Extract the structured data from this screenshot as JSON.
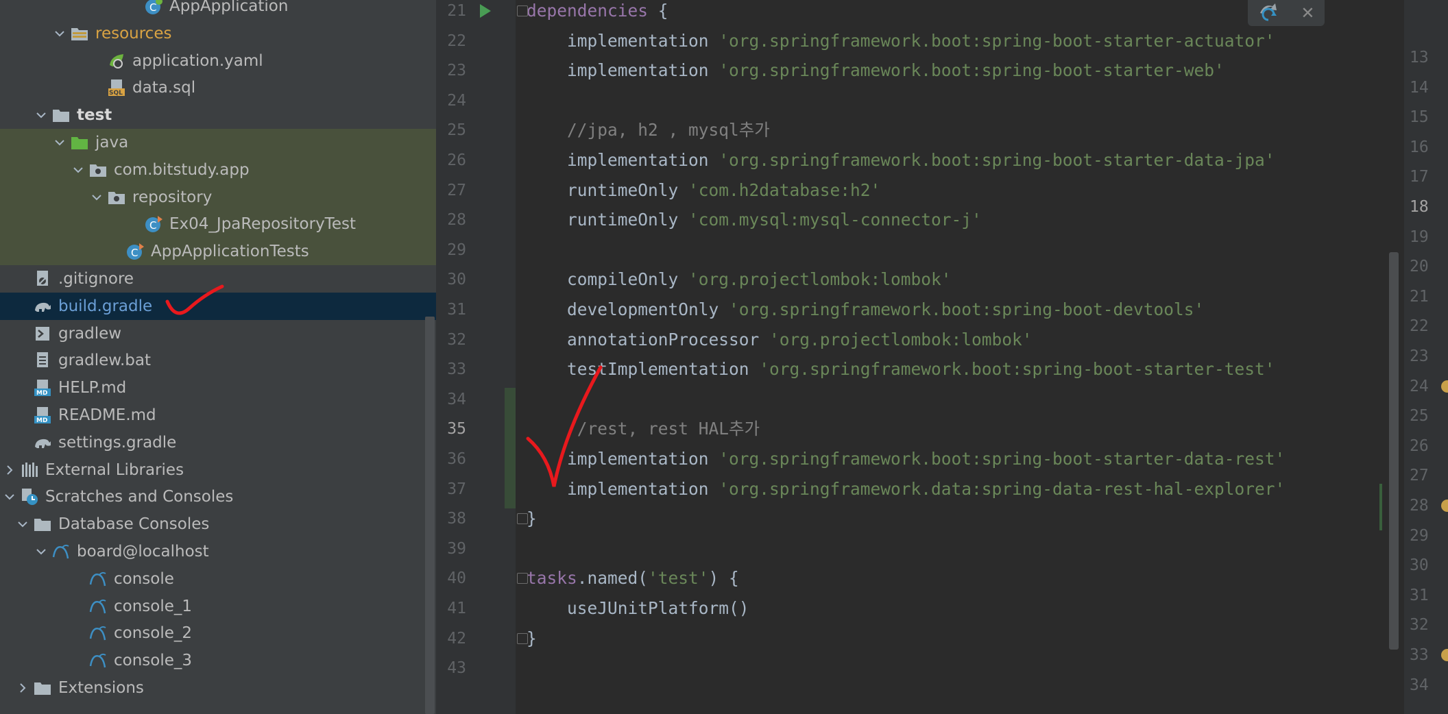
{
  "tree": {
    "items": [
      {
        "label": "AppApplication",
        "indent": 7,
        "arrow": "",
        "icon": "spring-class-icon",
        "style": "",
        "scope": ""
      },
      {
        "label": "resources",
        "indent": 3,
        "arrow": "v",
        "icon": "resources-folder-icon",
        "style": "",
        "scope": ""
      },
      {
        "label": "application.yaml",
        "indent": 5,
        "arrow": "",
        "icon": "spring-yaml-icon",
        "style": "",
        "scope": ""
      },
      {
        "label": "data.sql",
        "indent": 5,
        "arrow": "",
        "icon": "sql-file-icon",
        "style": "",
        "scope": ""
      },
      {
        "label": "test",
        "indent": 2,
        "arrow": "v",
        "icon": "folder-icon",
        "style": "bold",
        "scope": ""
      },
      {
        "label": "java",
        "indent": 3,
        "arrow": "v",
        "icon": "test-folder-icon",
        "style": "",
        "scope": "test"
      },
      {
        "label": "com.bitstudy.app",
        "indent": 4,
        "arrow": "v",
        "icon": "package-icon",
        "style": "",
        "scope": "test"
      },
      {
        "label": "repository",
        "indent": 5,
        "arrow": "v",
        "icon": "package-icon",
        "style": "",
        "scope": "test"
      },
      {
        "label": "Ex04_JpaRepositoryTest",
        "indent": 7,
        "arrow": "",
        "icon": "test-class-icon",
        "style": "",
        "scope": "test"
      },
      {
        "label": "AppApplicationTests",
        "indent": 6,
        "arrow": "",
        "icon": "test-class-icon",
        "style": "",
        "scope": "test"
      },
      {
        "label": ".gitignore",
        "indent": 1,
        "arrow": "",
        "icon": "gitignore-file-icon",
        "style": "",
        "scope": ""
      },
      {
        "label": "build.gradle",
        "indent": 1,
        "arrow": "",
        "icon": "gradle-icon",
        "style": "blue",
        "scope": "selected"
      },
      {
        "label": "gradlew",
        "indent": 1,
        "arrow": "",
        "icon": "shell-script-icon",
        "style": "",
        "scope": ""
      },
      {
        "label": "gradlew.bat",
        "indent": 1,
        "arrow": "",
        "icon": "text-file-icon",
        "style": "",
        "scope": ""
      },
      {
        "label": "HELP.md",
        "indent": 1,
        "arrow": "",
        "icon": "markdown-icon",
        "style": "",
        "scope": ""
      },
      {
        "label": "README.md",
        "indent": 1,
        "arrow": "",
        "icon": "markdown-icon",
        "style": "",
        "scope": ""
      },
      {
        "label": "settings.gradle",
        "indent": 1,
        "arrow": "",
        "icon": "gradle-icon",
        "style": "",
        "scope": ""
      },
      {
        "label": "External Libraries",
        "indent": 0,
        "arrow": ">",
        "icon": "libraries-icon",
        "style": "",
        "scope": ""
      },
      {
        "label": "Scratches and Consoles",
        "indent": 0,
        "arrow": "v",
        "icon": "scratches-icon",
        "style": "",
        "scope": ""
      },
      {
        "label": "Database Consoles",
        "indent": 1,
        "arrow": "v",
        "icon": "folder-icon",
        "style": "",
        "scope": ""
      },
      {
        "label": "board@localhost",
        "indent": 2,
        "arrow": "v",
        "icon": "mysql-icon",
        "style": "",
        "scope": ""
      },
      {
        "label": "console",
        "indent": 4,
        "arrow": "",
        "icon": "mysql-icon",
        "style": "",
        "scope": ""
      },
      {
        "label": "console_1",
        "indent": 4,
        "arrow": "",
        "icon": "mysql-icon",
        "style": "",
        "scope": ""
      },
      {
        "label": "console_2",
        "indent": 4,
        "arrow": "",
        "icon": "mysql-icon",
        "style": "",
        "scope": ""
      },
      {
        "label": "console_3",
        "indent": 4,
        "arrow": "",
        "icon": "mysql-icon",
        "style": "",
        "scope": ""
      },
      {
        "label": "Extensions",
        "indent": 1,
        "arrow": ">",
        "icon": "folder-icon",
        "style": "",
        "scope": ""
      }
    ]
  },
  "editor": {
    "current_line": "35",
    "lines": [
      {
        "n": "21",
        "tokens": [
          {
            "t": "dependencies",
            "c": "purple"
          },
          {
            "t": " {",
            "c": ""
          }
        ]
      },
      {
        "n": "22",
        "tokens": [
          {
            "t": "    implementation ",
            "c": ""
          },
          {
            "t": "'org.springframework.boot:spring-boot-starter-actuator'",
            "c": "str"
          }
        ]
      },
      {
        "n": "23",
        "tokens": [
          {
            "t": "    implementation ",
            "c": ""
          },
          {
            "t": "'org.springframework.boot:spring-boot-starter-web'",
            "c": "str"
          }
        ]
      },
      {
        "n": "24",
        "tokens": []
      },
      {
        "n": "25",
        "tokens": [
          {
            "t": "    //jpa, h2 , mysql추가",
            "c": "cmt"
          }
        ]
      },
      {
        "n": "26",
        "tokens": [
          {
            "t": "    implementation ",
            "c": ""
          },
          {
            "t": "'org.springframework.boot:spring-boot-starter-data-jpa'",
            "c": "str"
          }
        ]
      },
      {
        "n": "27",
        "tokens": [
          {
            "t": "    runtimeOnly ",
            "c": ""
          },
          {
            "t": "'com.h2database:h2'",
            "c": "str"
          }
        ]
      },
      {
        "n": "28",
        "tokens": [
          {
            "t": "    runtimeOnly ",
            "c": ""
          },
          {
            "t": "'com.mysql:mysql-connector-j'",
            "c": "str"
          }
        ]
      },
      {
        "n": "29",
        "tokens": []
      },
      {
        "n": "30",
        "tokens": [
          {
            "t": "    compileOnly ",
            "c": ""
          },
          {
            "t": "'org.projectlombok:lombok'",
            "c": "str"
          }
        ]
      },
      {
        "n": "31",
        "tokens": [
          {
            "t": "    developmentOnly ",
            "c": ""
          },
          {
            "t": "'org.springframework.boot:spring-boot-devtools'",
            "c": "str"
          }
        ]
      },
      {
        "n": "32",
        "tokens": [
          {
            "t": "    annotationProcessor ",
            "c": ""
          },
          {
            "t": "'org.projectlombok:lombok'",
            "c": "str"
          }
        ]
      },
      {
        "n": "33",
        "tokens": [
          {
            "t": "    testImplementation ",
            "c": ""
          },
          {
            "t": "'org.springframework.boot:spring-boot-starter-test'",
            "c": "str"
          }
        ]
      },
      {
        "n": "34",
        "tokens": []
      },
      {
        "n": "35",
        "tokens": [
          {
            "t": "    //rest, rest HAL추가",
            "c": "cmt"
          }
        ]
      },
      {
        "n": "36",
        "tokens": [
          {
            "t": "    implementation ",
            "c": ""
          },
          {
            "t": "'org.springframework.boot:spring-boot-starter-data-rest'",
            "c": "str"
          }
        ]
      },
      {
        "n": "37",
        "tokens": [
          {
            "t": "    implementation ",
            "c": ""
          },
          {
            "t": "'org.springframework.data:spring-data-rest-hal-explorer'",
            "c": "str"
          }
        ]
      },
      {
        "n": "38",
        "tokens": [
          {
            "t": "}",
            "c": ""
          }
        ]
      },
      {
        "n": "39",
        "tokens": []
      },
      {
        "n": "40",
        "tokens": [
          {
            "t": "tasks",
            "c": "purple"
          },
          {
            "t": ".named(",
            "c": ""
          },
          {
            "t": "'test'",
            "c": "str"
          },
          {
            "t": ") {",
            "c": ""
          }
        ]
      },
      {
        "n": "41",
        "tokens": [
          {
            "t": "    useJUnitPlatform()",
            "c": ""
          }
        ]
      },
      {
        "n": "42",
        "tokens": [
          {
            "t": "}",
            "c": ""
          }
        ]
      },
      {
        "n": "43",
        "tokens": []
      }
    ]
  },
  "right_gutter": {
    "current_line": "18",
    "numbers": [
      "13",
      "14",
      "15",
      "16",
      "17",
      "18",
      "19",
      "20",
      "21",
      "22",
      "23",
      "24",
      "25",
      "26",
      "27",
      "28",
      "29",
      "30",
      "31",
      "32",
      "33",
      "34"
    ]
  },
  "colors": {
    "tree_bg": "#3c3f41",
    "editor_bg": "#2b2b2b",
    "string": "#6a8759",
    "comment": "#808080",
    "dsl_keyword": "#9876aa",
    "selection": "#0d293e",
    "test_scope": "#49513c",
    "annotation_red": "#e8191d"
  }
}
